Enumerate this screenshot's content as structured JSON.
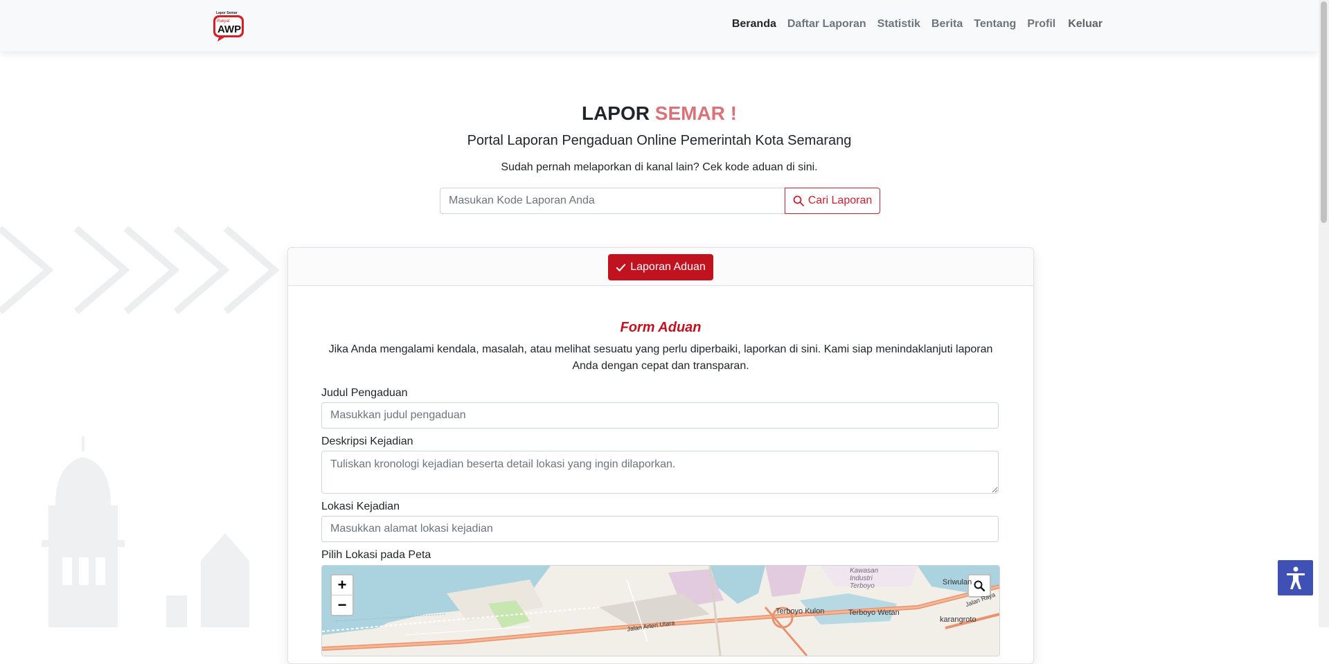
{
  "logo": {
    "text": "AWP",
    "tagline": "Lapor Semar",
    "sub": "Rakyat"
  },
  "nav": {
    "items": [
      "Beranda",
      "Daftar Laporan",
      "Statistik",
      "Berita",
      "Tentang",
      "Profil"
    ],
    "logout": "Keluar"
  },
  "hero": {
    "title_main": "LAPOR",
    "title_accent": "SEMAR !",
    "subtitle": "Portal Laporan Pengaduan Online Pemerintah Kota Semarang",
    "hint": "Sudah pernah melaporkan di kanal lain? Cek kode aduan di sini."
  },
  "search": {
    "placeholder": "Masukan Kode Laporan Anda",
    "button": "Cari Laporan"
  },
  "card": {
    "tab_label": "Laporan Aduan",
    "form_title": "Form Aduan",
    "form_desc": "Jika Anda mengalami kendala, masalah, atau melihat sesuatu yang perlu diperbaiki, laporkan di sini. Kami siap menindaklanjuti laporan Anda dengan cepat dan transparan."
  },
  "form": {
    "judul_label": "Judul Pengaduan",
    "judul_placeholder": "Masukkan judul pengaduan",
    "deskripsi_label": "Deskripsi Kejadian",
    "deskripsi_placeholder": "Tuliskan kronologi kejadian beserta detail lokasi yang ingin dilaporkan.",
    "lokasi_label": "Lokasi Kejadian",
    "lokasi_placeholder": "Masukkan alamat lokasi kejadian",
    "peta_label": "Pilih Lokasi pada Peta"
  },
  "map": {
    "zoom_in": "+",
    "zoom_out": "−",
    "labels": {
      "kawasan": "Kawasan Industri Terboyo",
      "terboyo_kulon": "Terboyo Kulon",
      "terboyo_wetan": "Terboyo Wetan",
      "sriwulan": "Sriwulan",
      "karangroto": "karangroto",
      "jalan_raya": "Jalan Raya",
      "jalan_arteri": "Jalan Arteri Utara"
    }
  },
  "colors": {
    "brand_red": "#c1121f",
    "accent_pink": "#d97378",
    "a11y_blue": "#3f51b5"
  }
}
